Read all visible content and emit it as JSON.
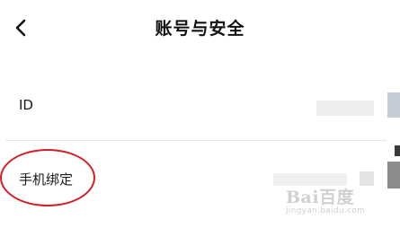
{
  "header": {
    "title": "账号与安全",
    "back_icon": "chevron-left-icon"
  },
  "rows": [
    {
      "label": "ID"
    },
    {
      "label": "手机绑定"
    }
  ],
  "annotation": {
    "color": "#d21f26"
  },
  "watermark": {
    "main": "Bai百度",
    "sub": "jingyan.baidu.com"
  }
}
